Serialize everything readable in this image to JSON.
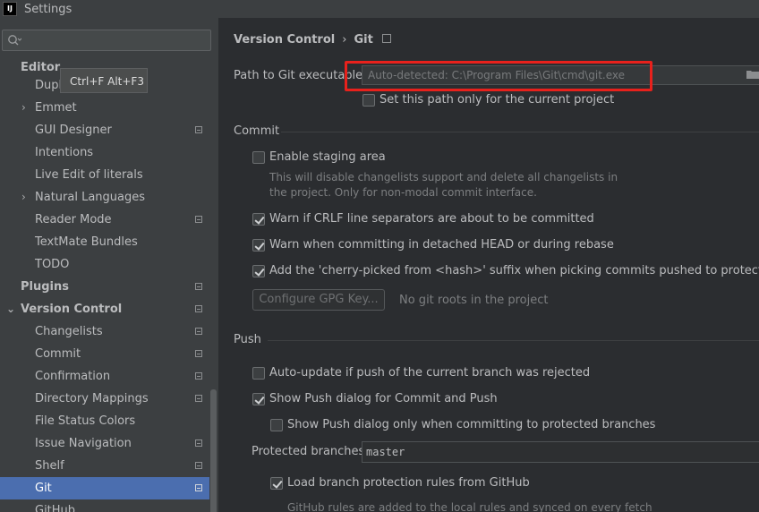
{
  "window": {
    "title": "Settings",
    "app_icon": "IJ"
  },
  "sidebar": {
    "search_placeholder": "",
    "tooltip": "Ctrl+F Alt+F3",
    "items": [
      {
        "label": "Editor"
      },
      {
        "label": "Dupl"
      },
      {
        "label": "Emmet"
      },
      {
        "label": "GUI Designer"
      },
      {
        "label": "Intentions"
      },
      {
        "label": "Live Edit of literals"
      },
      {
        "label": "Natural Languages"
      },
      {
        "label": "Reader Mode"
      },
      {
        "label": "TextMate Bundles"
      },
      {
        "label": "TODO"
      },
      {
        "label": "Plugins"
      },
      {
        "label": "Version Control"
      },
      {
        "label": "Changelists"
      },
      {
        "label": "Commit"
      },
      {
        "label": "Confirmation"
      },
      {
        "label": "Directory Mappings"
      },
      {
        "label": "File Status Colors"
      },
      {
        "label": "Issue Navigation"
      },
      {
        "label": "Shelf"
      },
      {
        "label": "Git"
      },
      {
        "label": "GitHub"
      }
    ]
  },
  "breadcrumb": {
    "parent": "Version Control",
    "separator": "›",
    "current": "Git"
  },
  "git_path": {
    "label": "Path to Git executable:",
    "placeholder": "Auto-detected: C:\\Program Files\\Git\\cmd\\git.exe",
    "current_project_only_label": "Set this path only for the current project",
    "current_project_only_checked": false
  },
  "commit": {
    "section_title": "Commit",
    "enable_staging_label": "Enable staging area",
    "enable_staging_checked": false,
    "staging_description_1": "This will disable changelists support and delete all changelists in",
    "staging_description_2": "the project. Only for non-modal commit interface.",
    "warn_crlf_label": "Warn if CRLF line separators are about to be committed",
    "warn_crlf_checked": true,
    "warn_detached_label": "Warn when committing in detached HEAD or during rebase",
    "warn_detached_checked": true,
    "cherry_pick_label": "Add the 'cherry-picked from <hash>' suffix when picking commits pushed to protected branch",
    "cherry_pick_checked": true,
    "gpg_button_label": "Configure GPG Key...",
    "no_roots_text": "No git roots in the project"
  },
  "push": {
    "section_title": "Push",
    "auto_update_label": "Auto-update if push of the current branch was rejected",
    "auto_update_checked": false,
    "show_push_dialog_label": "Show Push dialog for Commit and Push",
    "show_push_dialog_checked": true,
    "show_push_protected_label": "Show Push dialog only when committing to protected branches",
    "show_push_protected_checked": false,
    "protected_branches_label": "Protected branches:",
    "protected_branches_value": "master",
    "load_rules_label": "Load branch protection rules from GitHub",
    "load_rules_checked": true,
    "github_rules_note": "GitHub rules are added to the local rules and synced on every fetch"
  },
  "colors": {
    "selection": "#4b6eaf",
    "highlight_box": "#e8211c",
    "sidebar_bg": "#3c3f41",
    "content_bg": "#2b2d30"
  }
}
